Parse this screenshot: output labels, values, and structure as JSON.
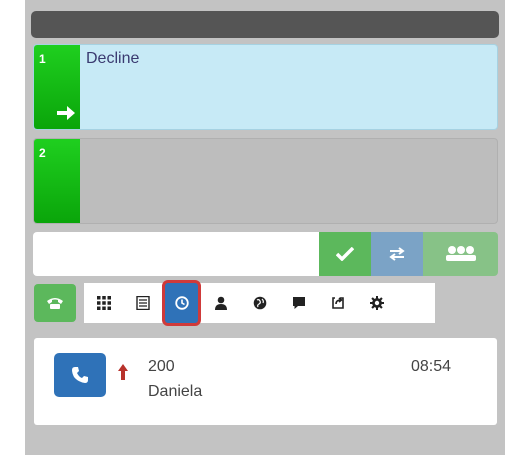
{
  "lines": [
    {
      "number": "1",
      "text": "Decline",
      "state": "incoming"
    },
    {
      "number": "2",
      "text": "",
      "state": "idle"
    }
  ],
  "dialer": {
    "value": ""
  },
  "icons": {
    "accept": "check-icon",
    "transfer": "transfer-icon",
    "conference": "conference-icon",
    "phone": "phone-icon",
    "tabs": [
      "dialpad-icon",
      "list-icon",
      "history-clock-icon",
      "contact-icon",
      "globe-icon",
      "chat-icon",
      "forward-icon",
      "gear-icon"
    ]
  },
  "active_tab": "history",
  "call_history": [
    {
      "number": "200",
      "name": "Daniela",
      "time": "08:54",
      "direction": "outgoing"
    }
  ],
  "colors": {
    "line_tab": "#0aa50a",
    "active_line": "#c7eaf6",
    "accept": "#5cb85c",
    "transfer": "#7ba3c6",
    "primary": "#2f72b8",
    "highlight": "#cf3a3a"
  }
}
